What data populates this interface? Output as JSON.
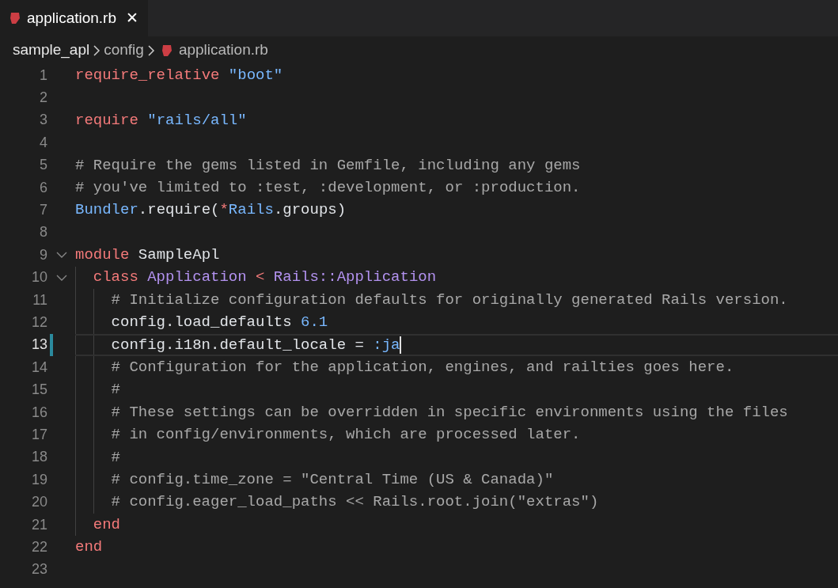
{
  "tab": {
    "label": "application.rb",
    "close": "✕",
    "selected": true
  },
  "breadcrumbs": [
    {
      "label": "sample_apl",
      "kind": "folder"
    },
    {
      "label": "config",
      "kind": "folder"
    },
    {
      "label": "application.rb",
      "kind": "file"
    }
  ],
  "lines": [
    {
      "number": "1",
      "current": false,
      "tokens": [
        {
          "kind": "keyword",
          "text": "require_relative"
        },
        {
          "kind": "string",
          "text": " \"boot\""
        }
      ]
    },
    {
      "number": "2",
      "current": false
    },
    {
      "number": "3",
      "current": false,
      "tokens": [
        {
          "kind": "keyword",
          "text": "require"
        },
        {
          "kind": "string",
          "text": " \"rails/all\""
        }
      ]
    },
    {
      "number": "4",
      "current": false
    },
    {
      "number": "5",
      "current": false,
      "tokens": [
        {
          "kind": "comment",
          "text": "# Require the gems listed in Gemfile, including any gems"
        }
      ]
    },
    {
      "number": "6",
      "current": false,
      "tokens": [
        {
          "kind": "comment",
          "text": "# you've limited to :test, :development, or :production."
        }
      ]
    },
    {
      "number": "7",
      "current": false,
      "tokens": [
        {
          "kind": "constant",
          "text": "Bundler"
        },
        {
          "kind": "plain",
          "text": ".require("
        },
        {
          "kind": "keyword",
          "text": "*"
        },
        {
          "kind": "constant",
          "text": "Rails"
        },
        {
          "kind": "plain",
          "text": ".groups)"
        }
      ]
    },
    {
      "number": "8",
      "current": false
    },
    {
      "number": "9",
      "current": false,
      "expanded": true,
      "tokens": [
        {
          "kind": "keyword",
          "text": "module"
        },
        {
          "kind": "plain",
          "text": " SampleApl"
        }
      ],
      "children": [
        {
          "number": "10",
          "current": false,
          "expanded": true,
          "tokens": [
            {
              "kind": "keyword",
              "text": "class"
            },
            {
              "kind": "class",
              "text": " Application"
            },
            {
              "kind": "keyword",
              "text": " <"
            },
            {
              "kind": "class",
              "text": " Rails::Application"
            }
          ],
          "children": [
            {
              "number": "11",
              "current": false,
              "tokens": [
                {
                  "kind": "comment",
                  "text": "# Initialize configuration defaults for originally generated Rails version."
                }
              ]
            },
            {
              "number": "12",
              "current": false,
              "tokens": [
                {
                  "kind": "plain",
                  "text": "config.load_defaults"
                },
                {
                  "kind": "number",
                  "text": " 6.1"
                }
              ]
            },
            {
              "number": "13",
              "current": true,
              "tokens": [
                {
                  "kind": "plain",
                  "text": "config.i18n.default_locale ="
                },
                {
                  "kind": "number",
                  "text": " :ja"
                }
              ]
            },
            {
              "number": "14",
              "current": false,
              "tokens": [
                {
                  "kind": "comment",
                  "text": "# Configuration for the application, engines, and railties goes here."
                }
              ]
            },
            {
              "number": "15",
              "current": false,
              "tokens": [
                {
                  "kind": "comment",
                  "text": "#"
                }
              ]
            },
            {
              "number": "16",
              "current": false,
              "tokens": [
                {
                  "kind": "comment",
                  "text": "# These settings can be overridden in specific environments using the files"
                }
              ]
            },
            {
              "number": "17",
              "current": false,
              "tokens": [
                {
                  "kind": "comment",
                  "text": "# in config/environments, which are processed later."
                }
              ]
            },
            {
              "number": "18",
              "current": false,
              "tokens": [
                {
                  "kind": "comment",
                  "text": "#"
                }
              ]
            },
            {
              "number": "19",
              "current": false,
              "tokens": [
                {
                  "kind": "comment",
                  "text": "# config.time_zone = \"Central Time (US & Canada)\""
                }
              ]
            },
            {
              "number": "20",
              "current": false,
              "tokens": [
                {
                  "kind": "comment",
                  "text": "# config.eager_load_paths << Rails.root.join(\"extras\")"
                }
              ]
            }
          ]
        },
        {
          "number": "21",
          "current": false,
          "tokens": [
            {
              "kind": "keyword",
              "text": "end"
            }
          ]
        }
      ]
    },
    {
      "number": "22",
      "current": false,
      "tokens": [
        {
          "kind": "keyword",
          "text": "end"
        }
      ]
    },
    {
      "number": "23",
      "current": false
    }
  ]
}
